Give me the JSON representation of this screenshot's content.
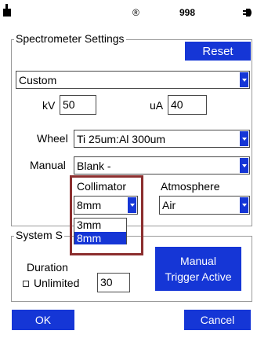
{
  "status_bar": {
    "registered_symbol": "®",
    "value": "998",
    "left_icon": "person-icon",
    "right_icon": "plug-icon"
  },
  "spectrometer": {
    "title": "Spectrometer Settings",
    "reset_label": "Reset",
    "mode_value": "Custom",
    "kv_label": "kV",
    "kv_value": "50",
    "ua_label": "uA",
    "ua_value": "40",
    "wheel_label": "Wheel",
    "wheel_value": "Ti 25um:Al 300um",
    "manual_label": "Manual",
    "manual_value": "Blank -",
    "collimator_label": "Collimator",
    "collimator_value": "8mm",
    "collimator_options": [
      "3mm",
      "8mm"
    ],
    "atmosphere_label": "Atmosphere",
    "atmosphere_value": "Air"
  },
  "system": {
    "title": "System S",
    "duration_label": "Duration",
    "duration_value": "30",
    "unlimited_label": "Unlimited",
    "trigger_label_line1": "Manual",
    "trigger_label_line2": "Trigger Active"
  },
  "footer": {
    "ok_label": "OK",
    "cancel_label": "Cancel"
  },
  "colors": {
    "accent": "#1536d6",
    "highlight": "#8b2e2e"
  }
}
